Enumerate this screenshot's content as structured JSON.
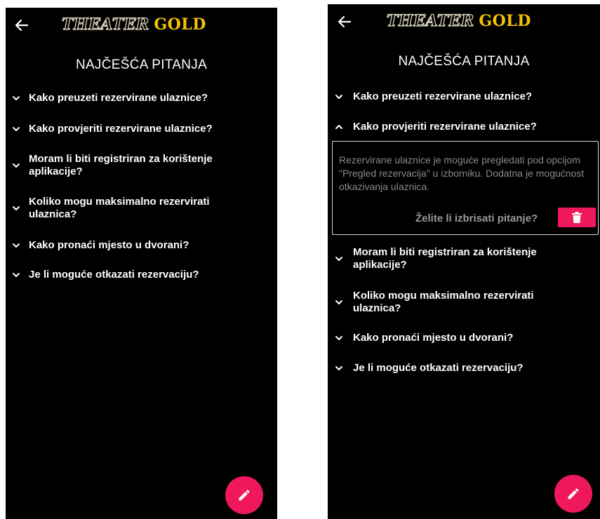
{
  "app": {
    "logo_word1": "THEATER",
    "logo_word2": "GOLD",
    "title": "NAJČEŠĆA PITANJA",
    "accent_color": "#f0185c",
    "logo_color": "#f5c400"
  },
  "icons": {
    "back": "arrow-left-icon",
    "collapsed": "chevron-down-icon",
    "expanded": "chevron-up-icon",
    "delete": "trash-icon",
    "edit": "pencil-icon"
  },
  "left_screen": {
    "state": "all-collapsed",
    "questions": [
      {
        "label": "Kako preuzeti rezervirane ulaznice?"
      },
      {
        "label": "Kako provjeriti rezervirane ulaznice?"
      },
      {
        "label": "Moram li biti registriran za korištenje aplikacije?"
      },
      {
        "label": "Koliko mogu maksimalno rezervirati ulaznica?"
      },
      {
        "label": "Kako pronaći mjesto u dvorani?"
      },
      {
        "label": "Je li moguće otkazati rezervaciju?"
      }
    ]
  },
  "right_screen": {
    "state": "question-2-expanded",
    "questions": [
      {
        "label": "Kako preuzeti rezervirane ulaznice?"
      },
      {
        "label": "Kako provjeriti rezervirane ulaznice?",
        "expanded": true
      },
      {
        "label": "Moram li biti registriran za korištenje aplikacije?"
      },
      {
        "label": "Koliko mogu maksimalno rezervirati ulaznica?"
      },
      {
        "label": "Kako pronaći mjesto u dvorani?"
      },
      {
        "label": "Je li moguće otkazati rezervaciju?"
      }
    ],
    "answer": {
      "text": "Rezervirane ulaznice je moguće pregledati pod opcijom \"Pregled rezervacija\" u izborniku. Dodatna je mogućnost otkazivanja ulaznica.",
      "delete_prompt": "Želite li izbrisati pitanje?"
    }
  }
}
